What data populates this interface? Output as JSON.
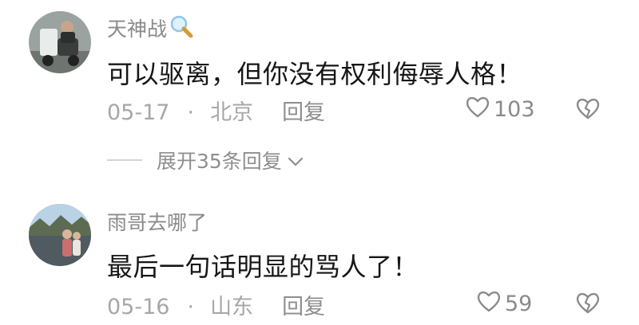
{
  "comments": [
    {
      "username": "天神战",
      "text": "可以驱离，但你没有权利侮辱人格！",
      "date": "05-17",
      "separator": "·",
      "location": "北京",
      "reply_label": "回复",
      "likes": "103"
    },
    {
      "username": "雨哥去哪了",
      "text": "最后一句话明显的骂人了！",
      "date": "05-16",
      "separator": "·",
      "location": "山东",
      "reply_label": "回复",
      "likes": "59"
    }
  ],
  "expand_replies": {
    "label": "展开35条回复",
    "icon": "chevron-down-icon"
  },
  "icons": {
    "username_emoji": "magnifier-icon",
    "like": "heart-outline-icon",
    "dislike": "broken-heart-icon"
  },
  "colors": {
    "text": "#161616",
    "secondary": "#8e8e8e",
    "muted": "#a7a7a7"
  }
}
